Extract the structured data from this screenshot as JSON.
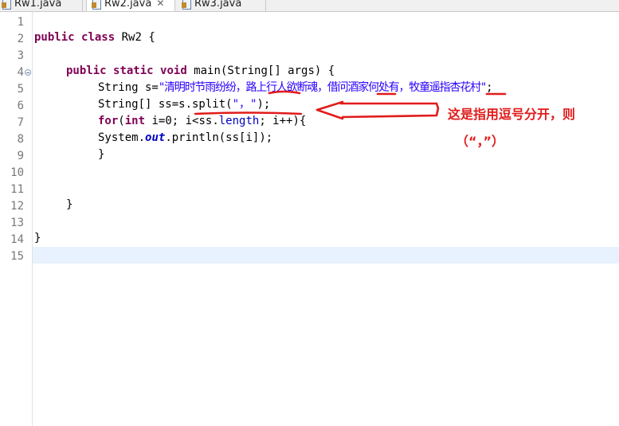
{
  "tabs": [
    {
      "label": "Rw1.java",
      "active": false
    },
    {
      "label": "Rw2.java",
      "active": true,
      "close_glyph": "✕"
    },
    {
      "label": "Rw3.java",
      "active": false
    }
  ],
  "editor": {
    "line_numbers": [
      "1",
      "2",
      "3",
      "4",
      "5",
      "6",
      "7",
      "8",
      "9",
      "10",
      "11",
      "12",
      "13",
      "14",
      "15"
    ],
    "folded_line": "4",
    "current_line": "15",
    "lines": {
      "l2": {
        "kw1": "public",
        "kw2": "class",
        "rest": " Rw2 {"
      },
      "l4": {
        "kw1": "public",
        "kw2": "static",
        "kw3": "void",
        "rest": " main(String[] args) {"
      },
      "l5": {
        "pre": "String s=",
        "str": "\"清明时节雨纷纷，路上行人欲断魂，借问酒家何处有，牧童遥指杏花村\"",
        "post": ";"
      },
      "l6": {
        "pre": "String[] ss=s.split(",
        "str": "\"，\"",
        "post": ");"
      },
      "l7": {
        "kw1": "for",
        "mid1": "(",
        "kw2": "int",
        "mid2": " i=0; i<ss.",
        "fld": "length",
        "post": "; i++){"
      },
      "l8": {
        "pre": "System.",
        "sfld": "out",
        "post": ".println(ss[i]);"
      },
      "l9": {
        "text": "}"
      },
      "l12": {
        "text": "}"
      },
      "l14": {
        "text": "}"
      }
    }
  },
  "annotation": {
    "line1": "这是指用逗号分开，则",
    "line2": "（“，”）",
    "color": "#e11b1b"
  }
}
